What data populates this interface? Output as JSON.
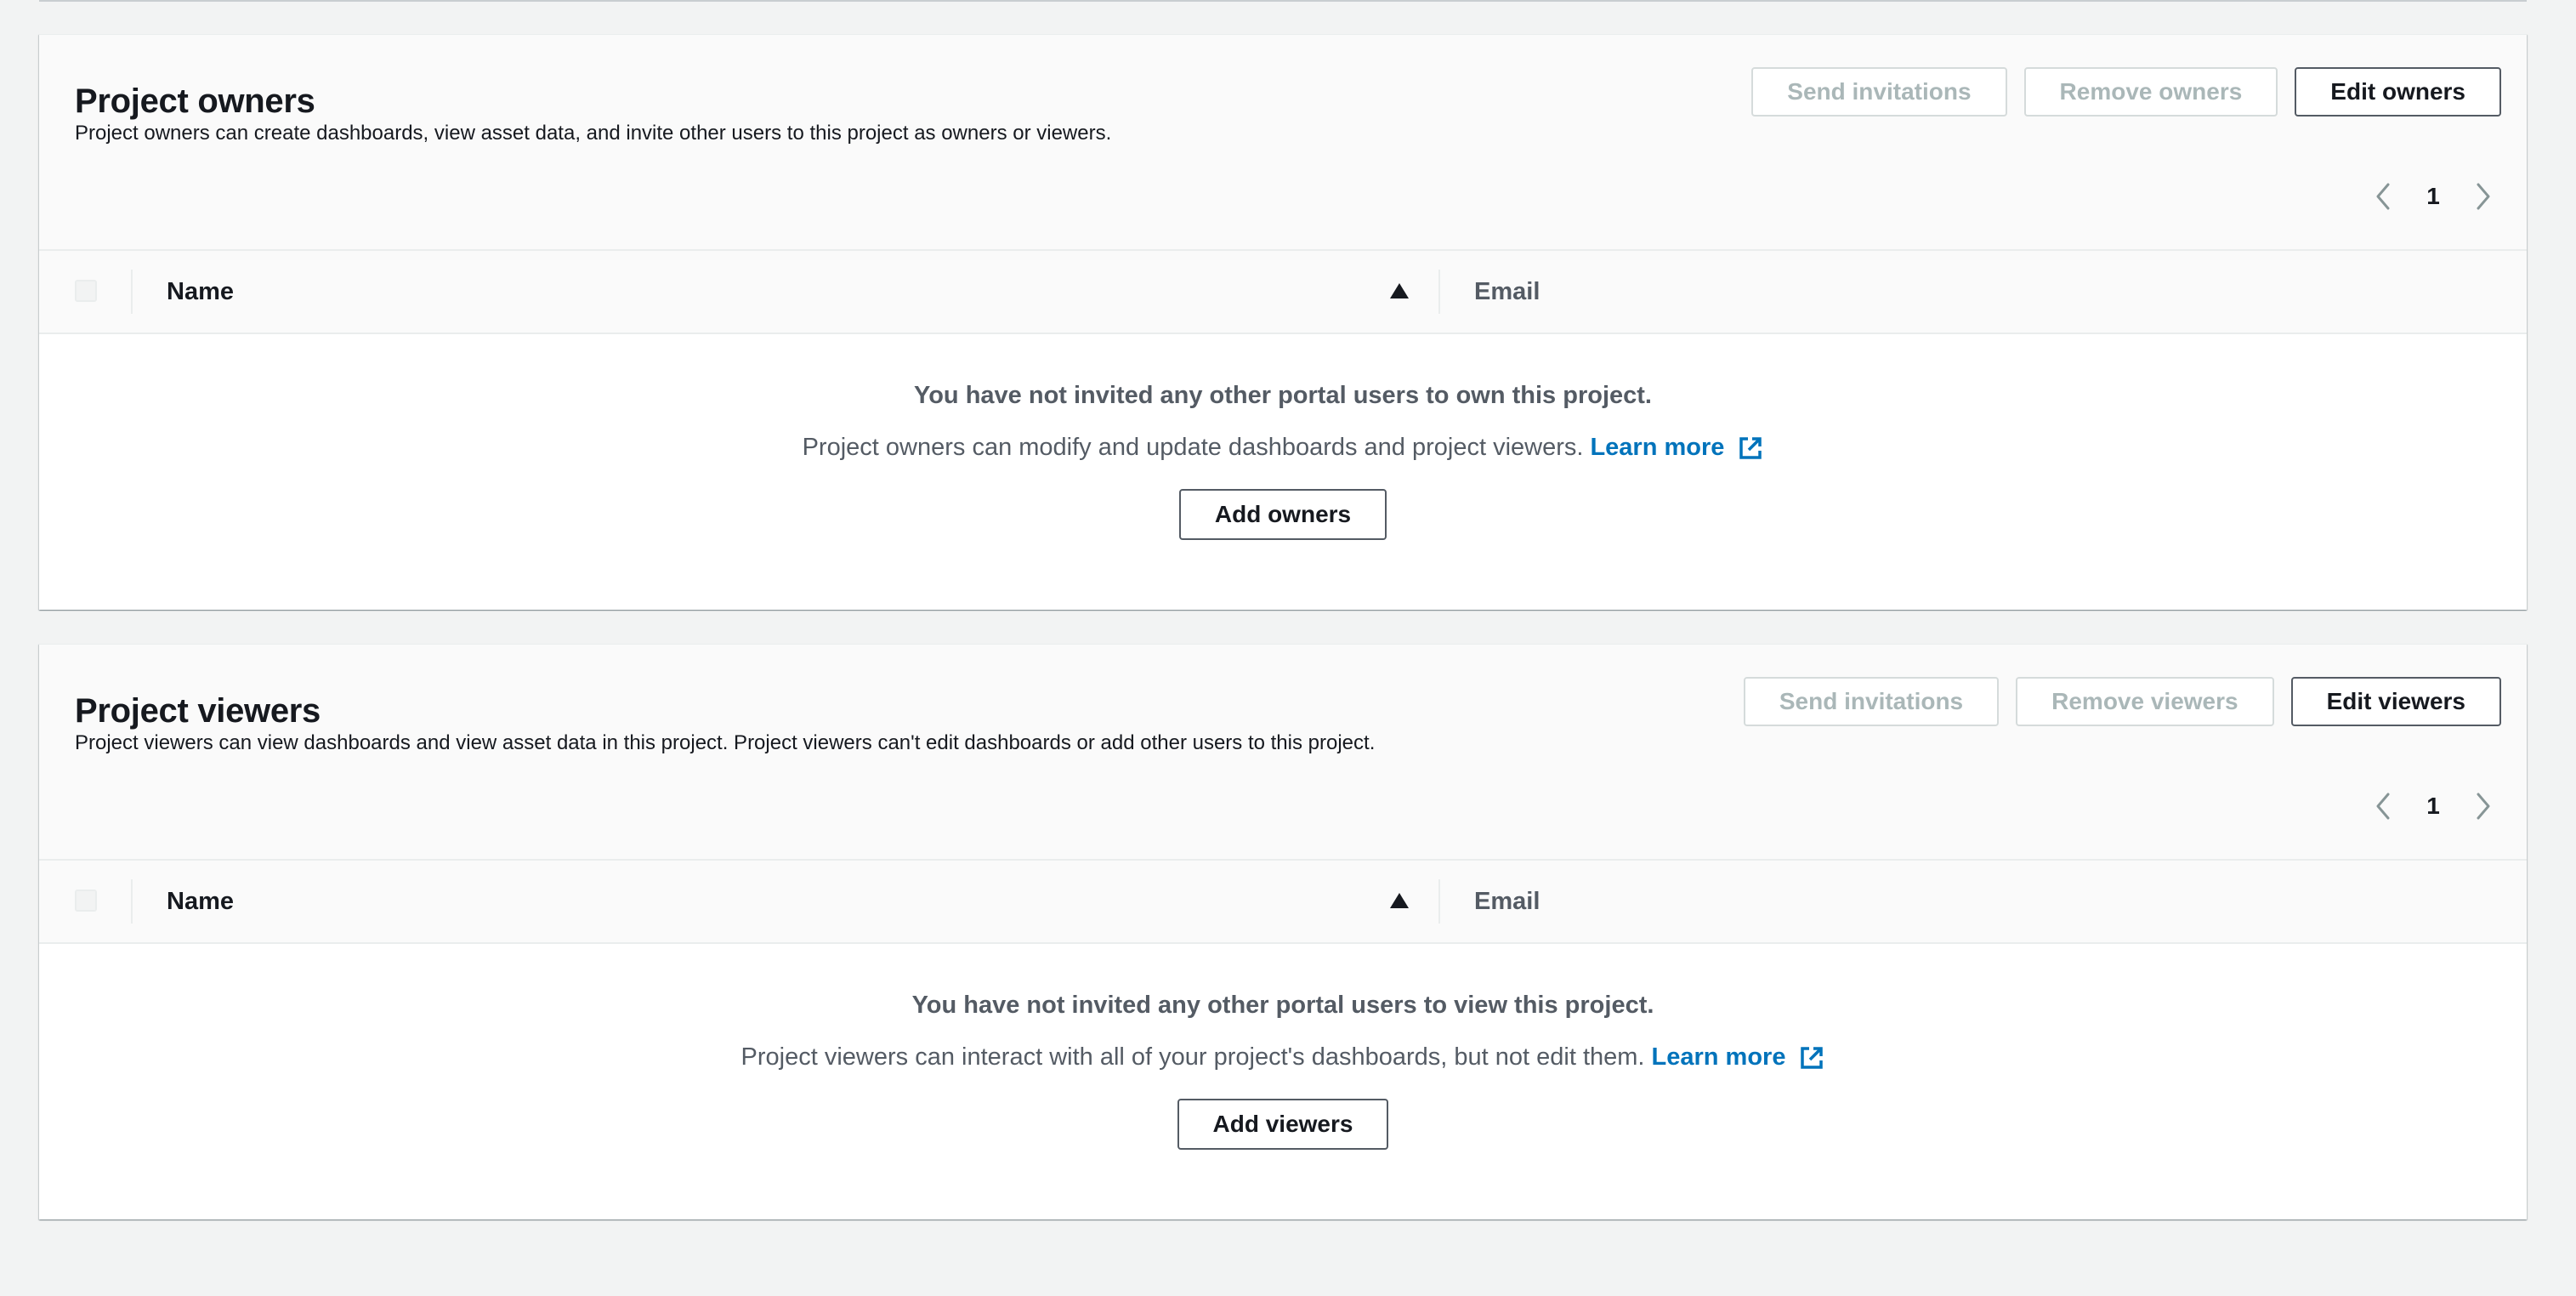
{
  "owners": {
    "title": "Project owners",
    "description": "Project owners can create dashboards, view asset data, and invite other users to this project as owners or viewers.",
    "actions": {
      "send_invitations": "Send invitations",
      "remove": "Remove owners",
      "edit": "Edit owners"
    },
    "pagination": {
      "page": "1"
    },
    "columns": {
      "name": "Name",
      "email": "Email"
    },
    "empty": {
      "title": "You have not invited any other portal users to own this project.",
      "message": "Project owners can modify and update dashboards and project viewers.",
      "learn_more": "Learn more",
      "add_button": "Add owners"
    }
  },
  "viewers": {
    "title": "Project viewers",
    "description": "Project viewers can view dashboards and view asset data in this project. Project viewers can't edit dashboards or add other users to this project.",
    "actions": {
      "send_invitations": "Send invitations",
      "remove": "Remove viewers",
      "edit": "Edit viewers"
    },
    "pagination": {
      "page": "1"
    },
    "columns": {
      "name": "Name",
      "email": "Email"
    },
    "empty": {
      "title": "You have not invited any other portal users to view this project.",
      "message": "Project viewers can interact with all of your project's dashboards, but not edit them.",
      "learn_more": "Learn more",
      "add_button": "Add viewers"
    }
  },
  "icons": {
    "prev": "chevron-left-icon",
    "next": "chevron-right-icon",
    "sort": "sort-ascending-icon",
    "external": "external-link-icon"
  },
  "colors": {
    "link": "#0073bb",
    "disabled_text": "#aab7b8",
    "page_background": "#f2f3f3"
  }
}
